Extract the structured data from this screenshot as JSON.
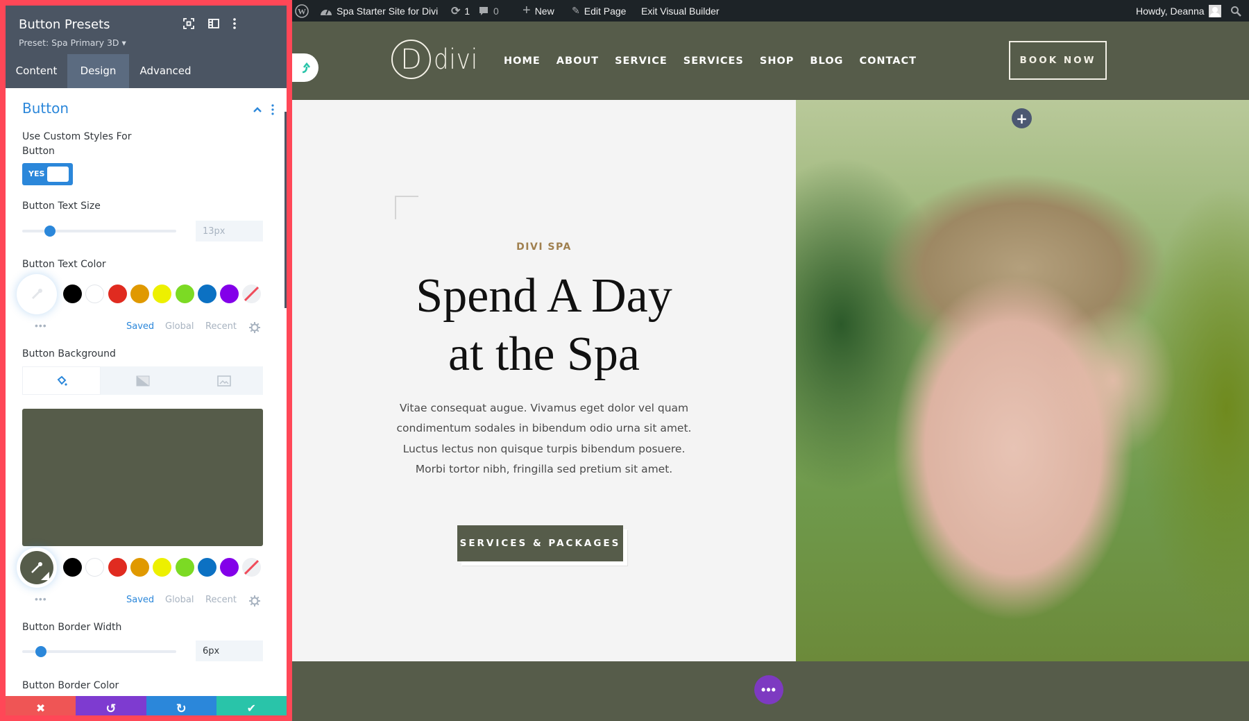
{
  "panel": {
    "title": "Button Presets",
    "preset_label": "Preset: Spa Primary 3D",
    "tabs": [
      {
        "label": "Content",
        "active": false
      },
      {
        "label": "Design",
        "active": true
      },
      {
        "label": "Advanced",
        "active": false
      }
    ],
    "section_title": "Button",
    "custom_styles_label": "Use Custom Styles For Button",
    "custom_styles_toggle": "YES",
    "text_size": {
      "label": "Button Text Size",
      "value": "13px"
    },
    "text_color": {
      "label": "Button Text Color",
      "swatches": [
        "#000000",
        "#ffffff",
        "#e02b20",
        "#e09900",
        "#edf000",
        "#7cda24",
        "#0c71c3",
        "#8300e9",
        "none"
      ],
      "palette_tabs": [
        "Saved",
        "Global",
        "Recent"
      ],
      "active_palette_tab": "Saved",
      "more": "•••"
    },
    "background": {
      "label": "Button Background",
      "tabs": [
        "color",
        "gradient",
        "image"
      ],
      "active_tab": "color",
      "color": "#565c4a",
      "swatches": [
        "#000000",
        "#ffffff",
        "#e02b20",
        "#e09900",
        "#edf000",
        "#7cda24",
        "#0c71c3",
        "#8300e9",
        "none"
      ],
      "palette_tabs": [
        "Saved",
        "Global",
        "Recent"
      ],
      "active_palette_tab": "Saved",
      "more": "•••"
    },
    "border_width": {
      "label": "Button Border Width",
      "value": "6px"
    },
    "border_color_label": "Button Border Color",
    "footer": {
      "discard": "✖",
      "undo": "↺",
      "redo": "↻",
      "save": "✔",
      "colors": {
        "discard": "#ef5555",
        "undo": "#7e3bd0",
        "redo": "#2b87da",
        "save": "#29c4a9"
      }
    }
  },
  "adminbar": {
    "site_name": "Spa Starter Site for Divi",
    "updates_count": "1",
    "comments_count": "0",
    "new_label": "New",
    "edit_page_label": "Edit Page",
    "exit_builder_label": "Exit Visual Builder",
    "greeting": "Howdy, Deanna"
  },
  "site": {
    "logo_letter": "D",
    "logo_word": "divi",
    "nav": [
      "HOME",
      "ABOUT",
      "SERVICE",
      "SERVICES",
      "SHOP",
      "BLOG",
      "CONTACT"
    ],
    "book_now": "BOOK NOW",
    "brand_color": "#565c4a"
  },
  "hero": {
    "eyebrow": "DIVI SPA",
    "headline_line1": "Spend A Day",
    "headline_line2": "at the Spa",
    "body": "Vitae consequat augue. Vivamus eget dolor vel quam condimentum sodales in bibendum odio urna sit amet. Luctus lectus non quisque turpis bibendum posuere. Morbi tortor nibh, fringilla sed pretium sit amet.",
    "cta": "SERVICES & PACKAGES",
    "add_label": "+",
    "more_label": "•••"
  }
}
